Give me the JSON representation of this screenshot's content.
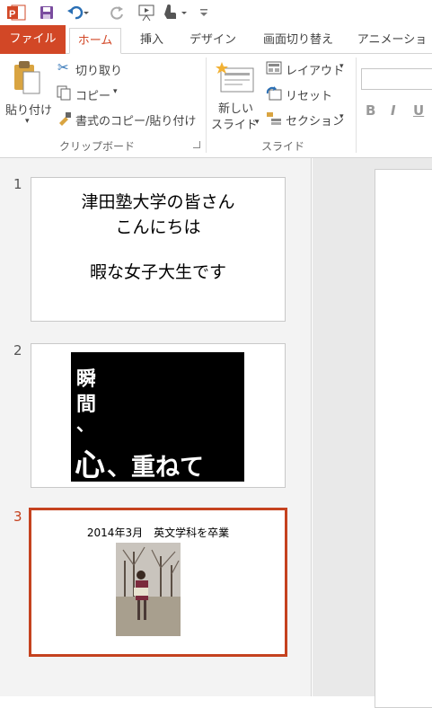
{
  "tabs": {
    "file": "ファイル",
    "home": "ホーム",
    "insert": "挿入",
    "design": "デザイン",
    "transitions": "画面切り替え",
    "animations": "アニメーション"
  },
  "clipboard": {
    "paste": "貼り付け",
    "cut": "切り取り",
    "copy": "コピー",
    "format_painter": "書式のコピー/貼り付け",
    "group_label": "クリップボード"
  },
  "slides_group": {
    "new_slide_line1": "新しい",
    "new_slide_line2": "スライド",
    "layout": "レイアウト",
    "reset": "リセット",
    "section": "セクション",
    "group_label": "スライド"
  },
  "font_buttons": {
    "bold": "B",
    "italic": "I",
    "underline": "U"
  },
  "slides": [
    {
      "number": "1",
      "line1": "津田塾大学の皆さん",
      "line2": "こんにちは",
      "line3": "暇な女子大生です"
    },
    {
      "number": "2",
      "char1": "瞬",
      "char2": "間",
      "char3": "、",
      "big": "心",
      "rest": "、重ねて"
    },
    {
      "number": "3",
      "caption": "2014年3月　英文学科を卒業"
    }
  ],
  "colors": {
    "accent": "#d24726",
    "selected_border": "#c5421f"
  }
}
